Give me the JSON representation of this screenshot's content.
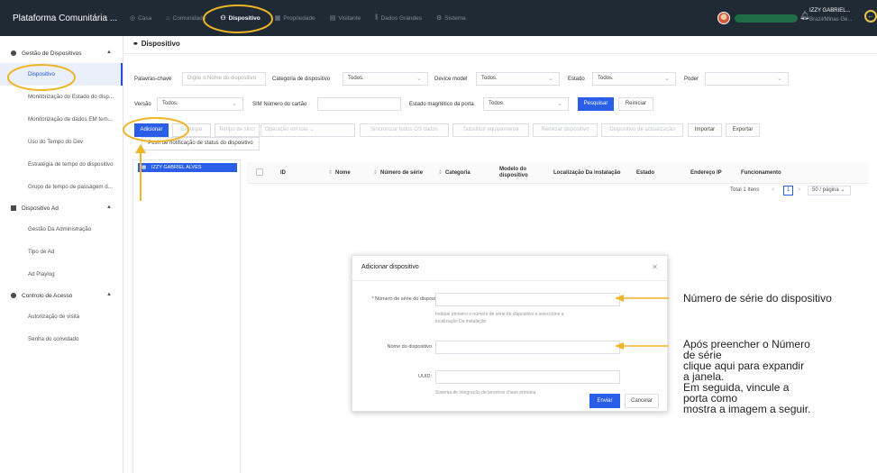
{
  "topbar": {
    "brand": "Plataforma Comunitária ...",
    "nav": [
      {
        "icon": "circle-icon",
        "glyph": "◎",
        "label": "Casa"
      },
      {
        "icon": "home-icon",
        "glyph": "⌂",
        "label": "Comunidade"
      },
      {
        "icon": "device-icon",
        "glyph": "⚇",
        "label": "Dispositivo"
      },
      {
        "icon": "property-icon",
        "glyph": "▦",
        "label": "Propriedade"
      },
      {
        "icon": "visitor-icon",
        "glyph": "▤",
        "label": "Visitante"
      },
      {
        "icon": "chart-icon",
        "glyph": "⫼",
        "label": "Dados Grandes"
      },
      {
        "icon": "settings-icon",
        "glyph": "⚙",
        "label": "Sistema"
      }
    ],
    "user_name": "IZZY GABRIEL...",
    "user_sub": "Brazil/Minas Ge..."
  },
  "sidebar": {
    "group1": "Gestão de Dispositivos",
    "group1_items": [
      "Dispositivo",
      "Monitorização do Estado do disp...",
      "Monitorização de dados EM tem...",
      "Uso do Tempo do Dev",
      "Estratégia de tempo do dispositivo",
      "Grupo de tempo de passagem d..."
    ],
    "group2": "Dispositivo Ad",
    "group2_items": [
      "Gestão Da Administração",
      "Tipo de Ad",
      "Ad Playlog"
    ],
    "group3": "Controlo de Acesso",
    "group3_items": [
      "Autorização de visita",
      "Senha do convidado"
    ]
  },
  "main": {
    "title": "Dispositivo",
    "filters": {
      "keyword_label": "Palavras-chave",
      "keyword_placeholder": "Digite o Nome do dispositivo",
      "category_label": "Categoria de dispositivo",
      "category_value": "Todos.",
      "model_label": "Device model",
      "model_value": "Todos.",
      "state_label": "Estado",
      "state_value": "Todos.",
      "power_label": "Poder",
      "version_label": "Versão",
      "version_value": "Todos.",
      "sim_label": "SIM Número do cartão",
      "magnetic_label": "Estado magnético da porta",
      "magnetic_value": "Todos.",
      "search_btn": "Pesquisar",
      "reset_btn": "Reiniciar"
    },
    "actions": {
      "add": "Adicionar",
      "purge": "Expurgar",
      "sync_time": "Tempo de sincr",
      "batch_op": "Operação em lote",
      "sync_all": "Sincronizar todos OS dados",
      "replace": "Substituir equipamento",
      "restart": "Reiniciar dispositivo",
      "update": "Dispositivo de actualização",
      "import": "Importar",
      "export": "Exportar",
      "push": "Push de notificação de status do dispositivo"
    },
    "tree_node": "IZZY GABRIEL ALVES",
    "columns": [
      "ID",
      "Nome",
      "Número de série",
      "Categoria",
      "Modelo do dispositivo",
      "Localização Da instalação",
      "Estado",
      "Endereço IP",
      "Funcionamento"
    ],
    "pager": {
      "total": "Total 1 Itens",
      "page": "1",
      "per_page": "50 / página"
    }
  },
  "dialog": {
    "title": "Adicionar dispositivo",
    "serial_label": "Número de série do disposi",
    "serial_hint_1": "Indique primeiro o número de série do dispositivo e seleccione a",
    "serial_hint_2": "localização Da instalação",
    "name_label": "Nome do dispositivo",
    "uuid_label": "UUID:",
    "uuid_hint": "Sistema de integração de terceiros chave primária",
    "submit": "Enviar",
    "cancel": "Cancelar"
  },
  "annotations": {
    "note1": "Número de série do dispositivo",
    "note2_lines": [
      "Após preencher o Número",
      "de série",
      "clique aqui para expandir",
      "a janela.",
      "Em seguida, vincule a",
      "porta como",
      "mostra a imagem a seguir."
    ]
  },
  "colors": {
    "accent": "#2a5ee8",
    "highlight": "#f0b429",
    "topbar": "#1f2a34"
  }
}
